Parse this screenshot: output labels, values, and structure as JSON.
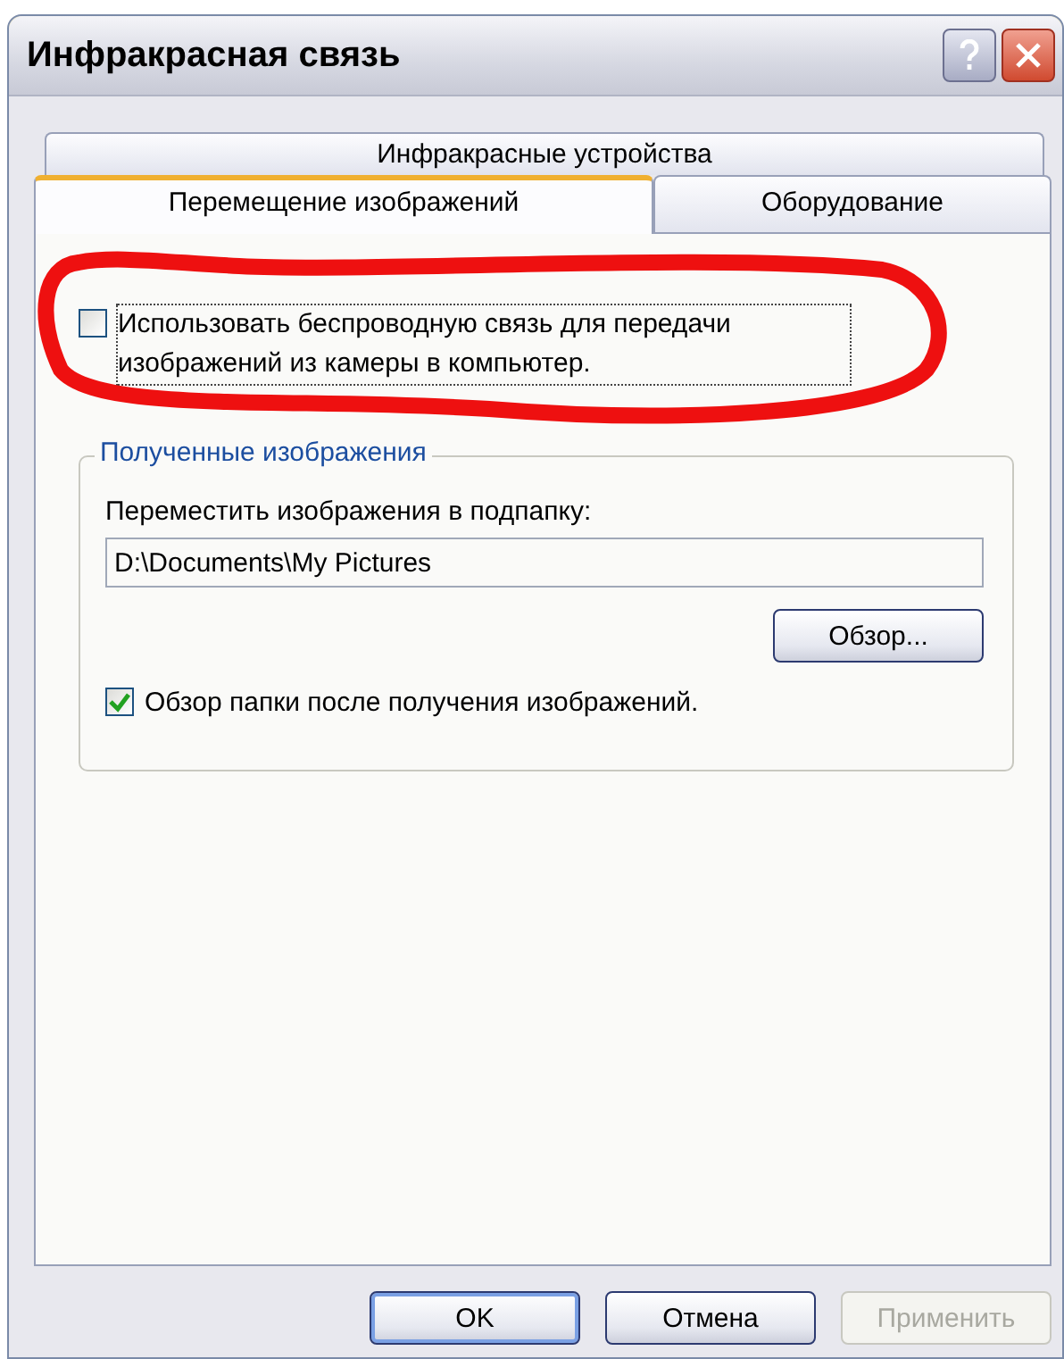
{
  "window": {
    "title": "Инфракрасная связь"
  },
  "tab_rows": [
    [
      {
        "label": "Инфракрасные устройства",
        "selected": false
      }
    ],
    [
      {
        "label": "Перемещение изображений",
        "selected": true
      },
      {
        "label": "Оборудование",
        "selected": false
      }
    ]
  ],
  "wireless_option": {
    "label": "Использовать беспроводную связь для передачи изображений из камеры в компьютер.",
    "checked": false
  },
  "received_images": {
    "title": "Полученные изображения",
    "folder_label": "Переместить изображения в подпапку:",
    "folder_value": "D:\\Documents\\My Pictures",
    "browse_button": "Обзор...",
    "browse_option": {
      "label": "Обзор папки после получения изображений.",
      "checked": true
    }
  },
  "buttons": [
    {
      "label": "OK",
      "disabled": false,
      "default": true
    },
    {
      "label": "Отмена",
      "disabled": false,
      "default": false
    },
    {
      "label": "Применить",
      "disabled": true,
      "default": false
    }
  ]
}
